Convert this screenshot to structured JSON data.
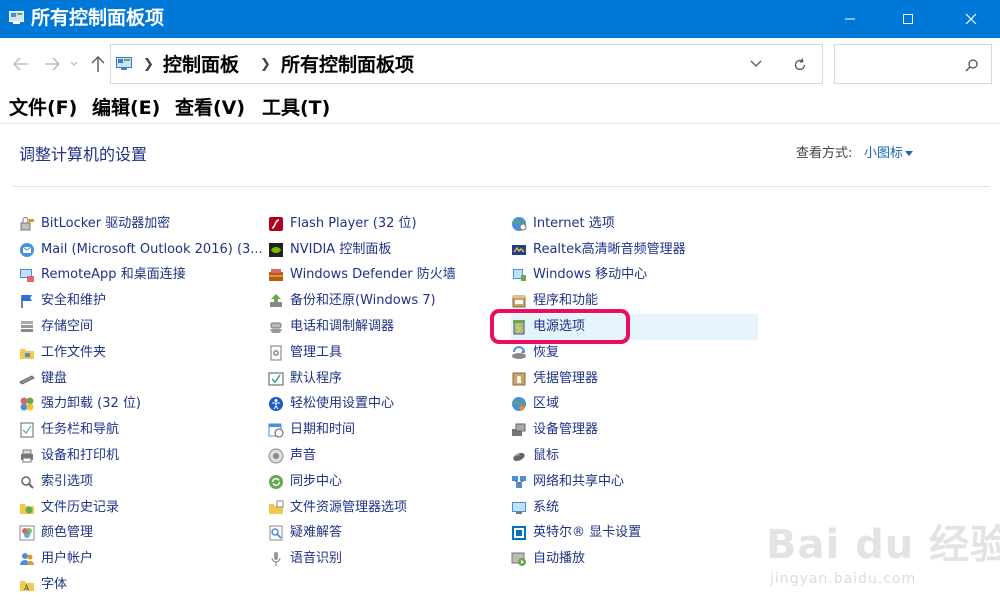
{
  "window": {
    "title": "所有控制面板项"
  },
  "address": {
    "crumbs": [
      "控制面板",
      "所有控制面板项"
    ],
    "search_placeholder": ""
  },
  "menu": [
    "文件(F)",
    "编辑(E)",
    "查看(V)",
    "工具(T)"
  ],
  "heading": "调整计算机的设置",
  "view": {
    "label": "查看方式:",
    "value": "小图标"
  },
  "columns": [
    [
      {
        "label": "BitLocker 驱动器加密",
        "icon": "bitlocker-icon"
      },
      {
        "label": "Mail (Microsoft Outlook 2016) (3...",
        "icon": "mail-icon"
      },
      {
        "label": "RemoteApp 和桌面连接",
        "icon": "remoteapp-icon"
      },
      {
        "label": "安全和维护",
        "icon": "flag-icon"
      },
      {
        "label": "存储空间",
        "icon": "storage-spaces-icon"
      },
      {
        "label": "工作文件夹",
        "icon": "work-folders-icon"
      },
      {
        "label": "键盘",
        "icon": "keyboard-icon"
      },
      {
        "label": "强力卸载 (32 位)",
        "icon": "uninstaller-icon"
      },
      {
        "label": "任务栏和导航",
        "icon": "taskbar-icon"
      },
      {
        "label": "设备和打印机",
        "icon": "printer-icon"
      },
      {
        "label": "索引选项",
        "icon": "indexing-icon"
      },
      {
        "label": "文件历史记录",
        "icon": "file-history-icon"
      },
      {
        "label": "颜色管理",
        "icon": "color-management-icon"
      },
      {
        "label": "用户帐户",
        "icon": "user-accounts-icon"
      },
      {
        "label": "字体",
        "icon": "fonts-icon"
      }
    ],
    [
      {
        "label": "Flash Player (32 位)",
        "icon": "flash-icon"
      },
      {
        "label": "NVIDIA 控制面板",
        "icon": "nvidia-icon"
      },
      {
        "label": "Windows Defender 防火墙",
        "icon": "firewall-icon"
      },
      {
        "label": "备份和还原(Windows 7)",
        "icon": "backup-icon"
      },
      {
        "label": "电话和调制解调器",
        "icon": "phone-modem-icon"
      },
      {
        "label": "管理工具",
        "icon": "admin-tools-icon"
      },
      {
        "label": "默认程序",
        "icon": "default-programs-icon"
      },
      {
        "label": "轻松使用设置中心",
        "icon": "ease-of-access-icon"
      },
      {
        "label": "日期和时间",
        "icon": "date-time-icon"
      },
      {
        "label": "声音",
        "icon": "sound-icon"
      },
      {
        "label": "同步中心",
        "icon": "sync-icon"
      },
      {
        "label": "文件资源管理器选项",
        "icon": "folder-options-icon"
      },
      {
        "label": "疑难解答",
        "icon": "troubleshoot-icon"
      },
      {
        "label": "语音识别",
        "icon": "microphone-icon"
      }
    ],
    [
      {
        "label": "Internet 选项",
        "icon": "internet-icon"
      },
      {
        "label": "Realtek高清晰音频管理器",
        "icon": "realtek-icon"
      },
      {
        "label": "Windows 移动中心",
        "icon": "mobility-icon"
      },
      {
        "label": "程序和功能",
        "icon": "programs-icon"
      },
      {
        "label": "电源选项",
        "icon": "power-icon",
        "selected": true
      },
      {
        "label": "恢复",
        "icon": "recovery-icon"
      },
      {
        "label": "凭据管理器",
        "icon": "credential-icon"
      },
      {
        "label": "区域",
        "icon": "region-icon"
      },
      {
        "label": "设备管理器",
        "icon": "device-manager-icon"
      },
      {
        "label": "鼠标",
        "icon": "mouse-icon"
      },
      {
        "label": "网络和共享中心",
        "icon": "network-icon"
      },
      {
        "label": "系统",
        "icon": "system-icon"
      },
      {
        "label": "英特尔® 显卡设置",
        "icon": "intel-graphics-icon"
      },
      {
        "label": "自动播放",
        "icon": "autoplay-icon"
      }
    ]
  ],
  "watermark": {
    "main": "Bai du 经验",
    "sub": "jingyan.baidu.com"
  }
}
